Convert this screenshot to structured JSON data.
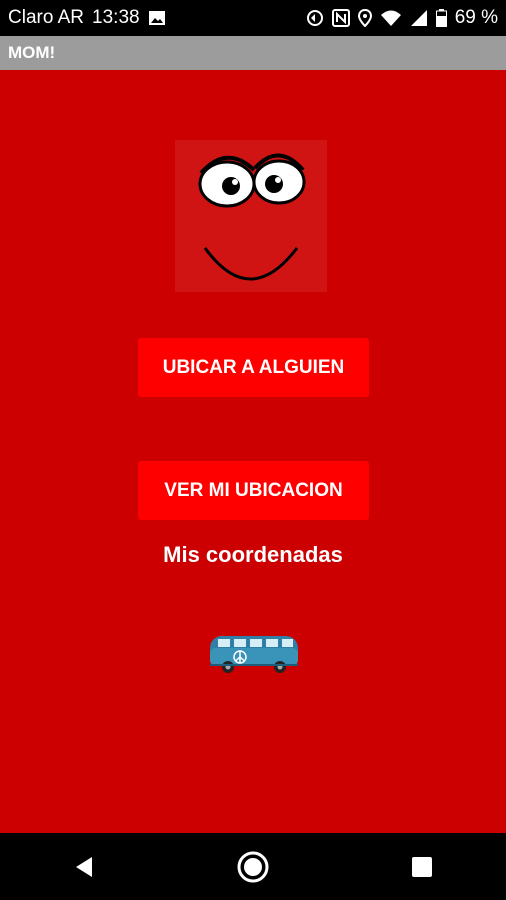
{
  "status_bar": {
    "carrier": "Claro AR",
    "time": "13:38",
    "battery": "69 %",
    "icons": [
      "image-icon",
      "sync-icon",
      "nfc-icon",
      "location-icon",
      "wifi-icon",
      "signal-icon",
      "battery-icon"
    ]
  },
  "app": {
    "title": "MOM!"
  },
  "main": {
    "background": "#cc0000",
    "button_color": "#ff0000",
    "locate_button": "UBICAR A ALGUIEN",
    "my_location_button": "VER MI UBICACION",
    "coords_label": "Mis coordenadas"
  },
  "nav_bar": {
    "icons": [
      "back-icon",
      "home-icon",
      "recents-icon"
    ]
  }
}
